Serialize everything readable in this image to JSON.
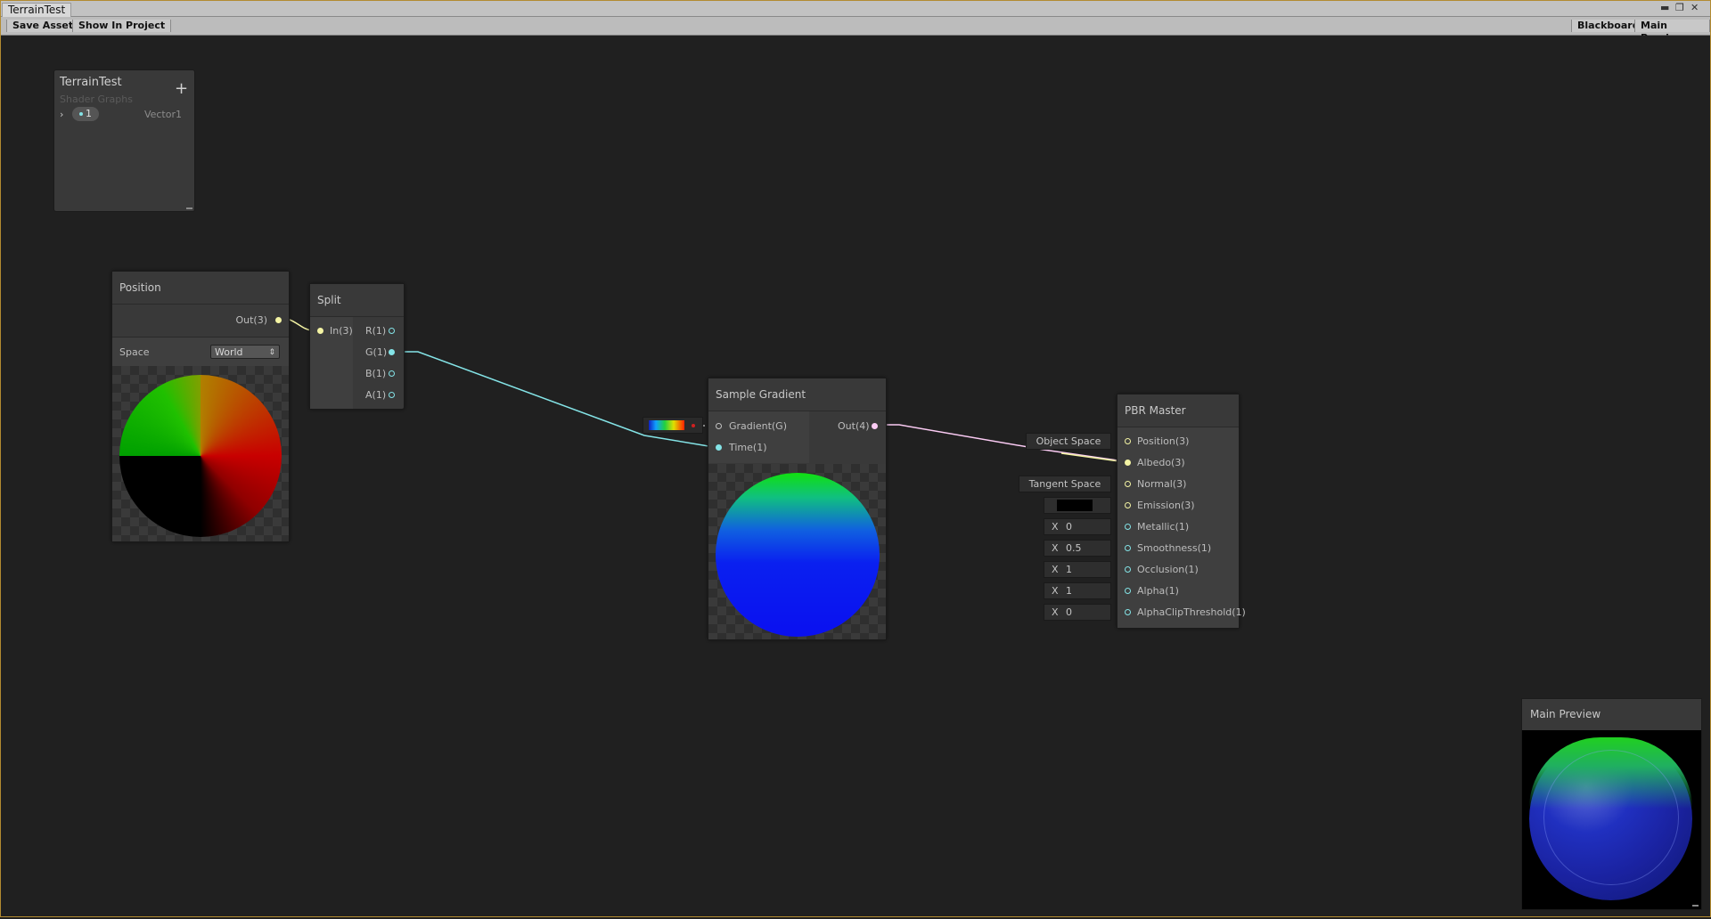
{
  "window": {
    "tab_title": "TerrainTest",
    "controls": [
      "▬",
      "❐",
      "✕"
    ]
  },
  "toolbar": {
    "save_asset": "Save Asset",
    "show_in_project": "Show In Project",
    "blackboard": "Blackboard",
    "main_preview": "Main Preview"
  },
  "blackboard": {
    "title": "TerrainTest",
    "subtitle": "Shader Graphs",
    "add": "+",
    "property_name": "1",
    "property_type": "Vector1"
  },
  "position_node": {
    "title": "Position",
    "out": "Out(3)",
    "space_label": "Space",
    "space_value": "World"
  },
  "split_node": {
    "title": "Split",
    "in": "In(3)",
    "outputs": [
      "R(1)",
      "G(1)",
      "B(1)",
      "A(1)"
    ]
  },
  "gradient_node": {
    "title": "Sample Gradient",
    "in_gradient": "Gradient(G)",
    "in_time": "Time(1)",
    "out": "Out(4)"
  },
  "pbr_node": {
    "title": "PBR Master",
    "inputs": [
      "Position(3)",
      "Albedo(3)",
      "Normal(3)",
      "Emission(3)",
      "Metallic(1)",
      "Smoothness(1)",
      "Occlusion(1)",
      "Alpha(1)",
      "AlphaClipThreshold(1)"
    ],
    "position_space": "Object Space",
    "normal_space": "Tangent Space",
    "x_label": "X",
    "metallic": "0",
    "smoothness": "0.5",
    "occlusion": "1",
    "alpha": "1",
    "alpha_clip": "0"
  },
  "main_preview": {
    "title": "Main Preview"
  },
  "colors": {
    "vector3": "#f4f4a4",
    "vector1": "#84e4e7",
    "vector4": "#fbcbf4",
    "gradient": "#c2c2c2",
    "accent": "#b38b31"
  }
}
